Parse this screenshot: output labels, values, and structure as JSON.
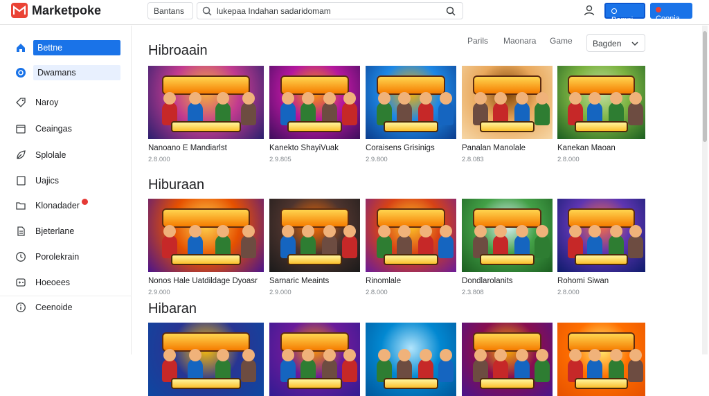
{
  "header": {
    "brand": "Marketpoke",
    "category_label": "Bantans",
    "search_value": "lukepaa Indahan sadaridomam",
    "btn_primary": "Bamni",
    "btn_secondary": "Coonia"
  },
  "sidebar": {
    "items": [
      {
        "label": "Bettne",
        "icon": "home-icon",
        "state": "active"
      },
      {
        "label": "Dwamans",
        "icon": "circle-icon",
        "state": "soft"
      },
      {
        "label": "Naroy",
        "icon": "tag-icon",
        "state": ""
      },
      {
        "label": "Ceaingas",
        "icon": "box-icon",
        "state": ""
      },
      {
        "label": "Splolale",
        "icon": "leaf-icon",
        "state": ""
      },
      {
        "label": "Uajics",
        "icon": "square-icon",
        "state": ""
      },
      {
        "label": "Klonadader",
        "icon": "folder-icon",
        "state": "",
        "badge": true
      },
      {
        "label": "Bjeterlane",
        "icon": "document-icon",
        "state": ""
      },
      {
        "label": "Porolekrain",
        "icon": "clock-icon",
        "state": ""
      },
      {
        "label": "Hoeoees",
        "icon": "gamepad-icon",
        "state": ""
      },
      {
        "label": "Ceenoide",
        "icon": "info-icon",
        "state": ""
      }
    ]
  },
  "filters": [
    "Parils",
    "Maonara",
    "Game"
  ],
  "sort_select": "Bagden",
  "sections": [
    {
      "title": "Hibroaain",
      "cards": [
        {
          "title": "Nanoano E Mandiarlst",
          "sub": "2.8.000",
          "banner": "GHAFOCG",
          "colors": [
            "#2a1f6e",
            "#c23b8f",
            "#f8b43b"
          ]
        },
        {
          "title": "Kanekto ShayiVuak",
          "sub": "2.9.805",
          "banner": "FALAS",
          "colors": [
            "#3c0e5c",
            "#b5179e",
            "#ff9e00"
          ]
        },
        {
          "title": "Coraisens Grisinigs",
          "sub": "2.9.800",
          "banner": "NUSRAD",
          "colors": [
            "#0b3c8c",
            "#1e88e5",
            "#ffb300"
          ]
        },
        {
          "title": "Panalan Manolale",
          "sub": "2.8.083",
          "banner": "FUARK",
          "colors": [
            "#f6d7a7",
            "#e9a85c",
            "#7b3f00"
          ]
        },
        {
          "title": "Kanekan Maoan",
          "sub": "2.8.000",
          "banner": "CEAMAR",
          "colors": [
            "#1b5e20",
            "#7cb342",
            "#c5e1a5"
          ]
        }
      ]
    },
    {
      "title": "Hiburaan",
      "cards": [
        {
          "title": "Nonos Hale Uatdildage Dyoasr",
          "sub": "2.9.000",
          "banner": "TAHRALS",
          "colors": [
            "#4a148c",
            "#e65100",
            "#ffd54f"
          ]
        },
        {
          "title": "Sarnaric Meaints",
          "sub": "2.9.000",
          "banner": "ROMAARS",
          "colors": [
            "#1a1a1a",
            "#4e342e",
            "#ff6f00"
          ]
        },
        {
          "title": "Rinomlale",
          "sub": "2.8.000",
          "banner": "NOKUUS",
          "colors": [
            "#6a1b9a",
            "#d84315",
            "#ffca28"
          ]
        },
        {
          "title": "Dondlarolanits",
          "sub": "2.3.808",
          "banner": "JAWNE",
          "colors": [
            "#1b5e20",
            "#43a047",
            "#e1f5fe"
          ]
        },
        {
          "title": "Rohomi Siwan",
          "sub": "2.8.000",
          "banner": "CAME",
          "colors": [
            "#0d1b6b",
            "#5e35b1",
            "#ff7043"
          ]
        }
      ]
    },
    {
      "title": "Hibaran",
      "cards": [
        {
          "title": "",
          "sub": "",
          "banner": "BOYNFICES",
          "colors": [
            "#0d47a1",
            "#283593",
            "#ffc107"
          ]
        },
        {
          "title": "",
          "sub": "",
          "banner": "CAGHOIN",
          "colors": [
            "#311b92",
            "#6a1b9a",
            "#ff9800"
          ]
        },
        {
          "title": "",
          "sub": "",
          "banner": "",
          "colors": [
            "#01579b",
            "#0288d1",
            "#b3e5fc"
          ]
        },
        {
          "title": "",
          "sub": "",
          "banner": "DAINGE",
          "colors": [
            "#4a148c",
            "#880e4f",
            "#ffb300"
          ]
        },
        {
          "title": "",
          "sub": "",
          "banner": "LUNDO",
          "colors": [
            "#e65100",
            "#ff6f00",
            "#fff176"
          ]
        }
      ]
    }
  ]
}
